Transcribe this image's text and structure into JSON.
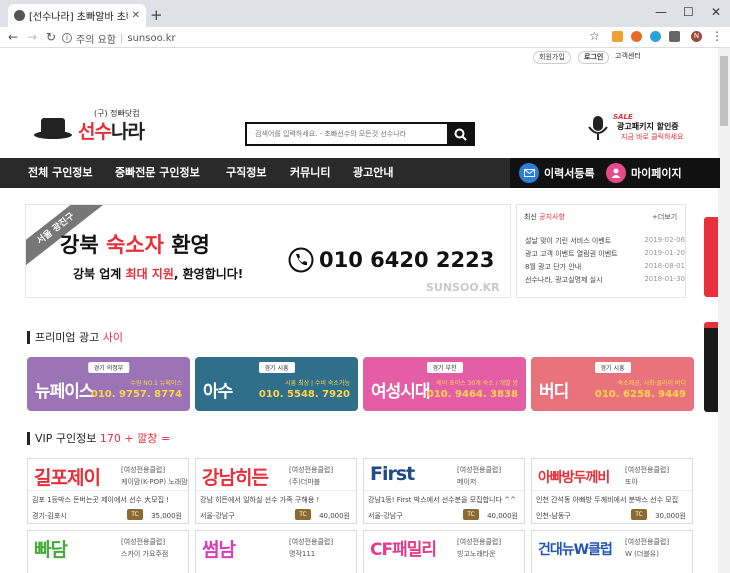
{
  "browser": {
    "tab_title": "[선수나라] 초빠알바 초빠나라",
    "address_label": "주의 요함",
    "url": "sunsoo.kr",
    "profile": "N"
  },
  "site": {
    "top_links": [
      "회원가입",
      "로그인",
      "고객센터"
    ],
    "logo_sub": "(구) 정빠닷컴",
    "logo_red": "선수",
    "logo_black": "나라",
    "search_placeholder": "검색어를 입력하세요. - 초빠선수의 모든것 선수나라",
    "promo_sale": "SALE",
    "promo_line1": "광고패키지 할인중",
    "promo_line2": "지금 바로 클릭하세요"
  },
  "menu": {
    "items": [
      "전체 구인정보",
      "중빠전문 구인정보",
      "구직정보",
      "커뮤니티",
      "광고안내"
    ],
    "resume": "이력서등록",
    "mypage": "마이페이지"
  },
  "banner": {
    "ribbon": "서울 광진구",
    "line1_a": "강북",
    "line1_b": "숙소자",
    "line1_c": "환영",
    "line2_a": "강북 업계",
    "line2_b": "최대 지원",
    "line2_c": ", 환영합니다!",
    "phone": "010 6420 2223",
    "watermark": "SUNSOO.KR"
  },
  "notice": {
    "title_a": "최신",
    "title_b": "공지사항",
    "more": "+더보기",
    "items": [
      {
        "text": "설날 맞이 기린 서비스 이벤트",
        "date": "2019-02-06"
      },
      {
        "text": "광고 고객 이벤트 열람권 이벤트",
        "date": "2019-01-20"
      },
      {
        "text": "8월 광고 단가 안내",
        "date": "2018-08-01"
      },
      {
        "text": "선수나라, 광고실명제 실시",
        "date": "2018-01-30"
      }
    ]
  },
  "premium": {
    "title_a": "프리미엄 광고",
    "title_b": "사이",
    "cards": [
      {
        "loc": "경기 의정부",
        "name": "뉴페이스",
        "info": "수원 NO.1 뉴페이스",
        "phone": "010. 9757. 8774",
        "color": "#9b74b5"
      },
      {
        "loc": "경기 시흥",
        "name": "아수",
        "info": "시흥 최상 | 수비 숙소가능",
        "phone": "010. 5548. 7920",
        "color": "#2f6f8c"
      },
      {
        "loc": "경기 부천",
        "name": "여성시대",
        "info": "케어 초이스 30개 숙소 / 개별 방",
        "phone": "010. 9464. 3838",
        "color": "#e45ea6"
      },
      {
        "loc": "경기 시흥",
        "name": "버디",
        "info": "숙소제공, 시화·클라이 버디",
        "phone": "010. 6258. 9449",
        "color": "#e8737c"
      }
    ]
  },
  "vip": {
    "title_a": "VIP 구인정보",
    "title_b": "170 + 깔창 =",
    "cards": [
      {
        "logo": "길포제이",
        "logo_color": "#e8303a",
        "cat": "[여성전용클럽]",
        "company": "케이맘(K-POP) 노래맘",
        "desc": "김포 1등박스 돈버는곳 제이에서 선수 大모집 !",
        "area": "경기-김포시",
        "pay": "35,000원"
      },
      {
        "logo": "강남히든",
        "logo_color": "#e8303a",
        "cat": "[여성전용클럽]",
        "company": "(주)더마블",
        "desc": "강남 히든에서 일하실 선수 가족 구해용 !",
        "area": "서울-강남구",
        "pay": "40,000원"
      },
      {
        "logo": "First",
        "logo_color": "#1f4a8c",
        "cat": "[여성전용클럽]",
        "company": "메이저",
        "desc": "강남1등! First 박스에서 선수분을 모집합니다 ^^",
        "area": "서울-강남구",
        "pay": "40,000원"
      },
      {
        "logo": "아빠방두께비",
        "logo_color": "#e8303a",
        "cat": "[여성전용클럽]",
        "company": "또아",
        "desc": "인천 간석동 아빠방 두께비에서 분박스 선수 모집",
        "area": "인천-남동구",
        "pay": "30,000원"
      },
      {
        "logo": "빠담",
        "logo_color": "#45a83a",
        "cat": "[여성전용클럽]",
        "company": "스카이 가요주점",
        "desc": "",
        "area": "",
        "pay": ""
      },
      {
        "logo": "썸남",
        "logo_color": "#d63fb8",
        "cat": "[여성전용클럽]",
        "company": "명작111",
        "desc": "",
        "area": "",
        "pay": ""
      },
      {
        "logo": "CF패밀리",
        "logo_color": "#e83a8a",
        "cat": "[여성전용클럽]",
        "company": "빙고노래타운",
        "desc": "",
        "area": "",
        "pay": ""
      },
      {
        "logo": "건대뉴W클럽",
        "logo_color": "#2355b5",
        "cat": "[여성전용클럽]",
        "company": "W (더블유)",
        "desc": "",
        "area": "",
        "pay": ""
      }
    ],
    "tc": "TC"
  },
  "side_banners": [
    "#e8303a",
    "#e8303a",
    "#e8303a"
  ]
}
